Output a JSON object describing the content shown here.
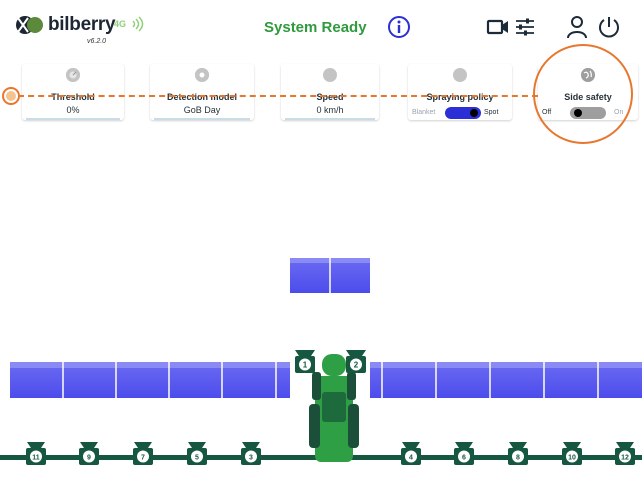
{
  "header": {
    "brand": "bilberry",
    "version": "v6.2.0",
    "network": "4G",
    "status": "System Ready",
    "icons": [
      "info-icon",
      "camera-icon",
      "settings-sliders-icon",
      "user-icon",
      "power-icon"
    ],
    "colors": {
      "status": "#2f9a3e",
      "network": "#8fd07a",
      "accent": "#2b2fd6"
    }
  },
  "cards": {
    "threshold": {
      "label": "Threshold",
      "value": "0%"
    },
    "detection_model": {
      "label": "Detection model",
      "value": "GoB Day"
    },
    "speed": {
      "label": "Speed",
      "value": "0 km/h"
    },
    "spraying_policy": {
      "label": "Spraying policy",
      "off_label": "Blanket",
      "on_label": "Spot",
      "state": "Spot"
    },
    "side_safety": {
      "label": "Side safety",
      "off_label": "Off",
      "on_label": "On",
      "state": "Off"
    }
  },
  "boom": {
    "camera_numbers_left": [
      "11",
      "9",
      "7",
      "5",
      "3"
    ],
    "camera_numbers_right": [
      "4",
      "6",
      "8",
      "10",
      "12"
    ],
    "center_cameras": [
      "1",
      "2"
    ],
    "colors": {
      "nozzle": "#5e5ef0",
      "boom_line": "#15573f",
      "tractor": "#2e9f45"
    }
  }
}
